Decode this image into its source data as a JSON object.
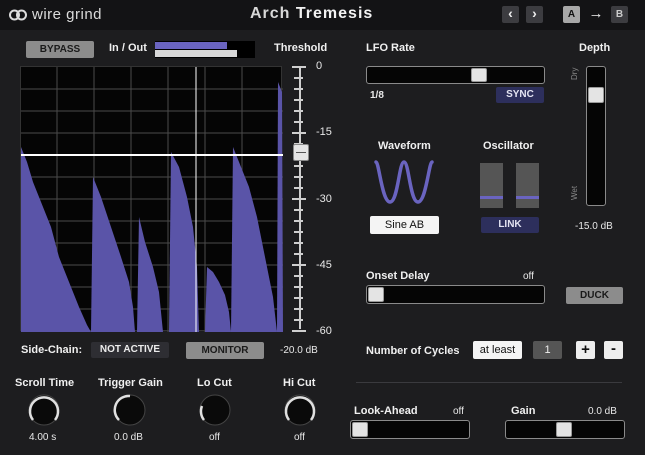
{
  "header": {
    "brand": "wire grind",
    "title_light": "Arch ",
    "title_bold": "Tremesis",
    "nav_prev": "‹",
    "nav_next": "›",
    "ab_a": "A",
    "ab_copy": "→",
    "ab_b": "B"
  },
  "meter": {
    "bypass_label": "BYPASS",
    "in_out_label": "In / Out",
    "in_level": 0.72,
    "out_level": 0.82
  },
  "threshold": {
    "label": "Threshold",
    "scale": [
      "0",
      "-15",
      "-30",
      "-45",
      "-60"
    ],
    "value": "-20.0 dB"
  },
  "sidechain": {
    "label": "Side-Chain:",
    "state": "NOT ACTIVE",
    "monitor": "MONITOR"
  },
  "knobs": [
    {
      "label": "Scroll Time",
      "value": "4.00 s"
    },
    {
      "label": "Trigger Gain",
      "value": "0.0 dB"
    },
    {
      "label": "Lo Cut",
      "value": "off"
    },
    {
      "label": "Hi Cut",
      "value": "off"
    }
  ],
  "lfo": {
    "label": "LFO Rate",
    "value": "1/8",
    "sync": "SYNC"
  },
  "depth": {
    "label": "Depth",
    "dry": "Dry",
    "wet": "Wet",
    "value": "-15.0 dB"
  },
  "waveform": {
    "label": "Waveform",
    "value": "Sine AB"
  },
  "oscillator": {
    "label": "Oscillator",
    "link": "LINK"
  },
  "onset": {
    "label": "Onset Delay",
    "value": "off",
    "duck": "DUCK"
  },
  "cycles": {
    "label": "Number of Cycles",
    "mode": "at least",
    "count": "1",
    "plus": "+",
    "minus": "-"
  },
  "lookahead": {
    "label": "Look-Ahead",
    "value": "off"
  },
  "gain": {
    "label": "Gain",
    "value": "0.0 dB"
  },
  "colors": {
    "accent": "#5c57a8",
    "background": "#1d1d1f",
    "header": "#131315"
  }
}
